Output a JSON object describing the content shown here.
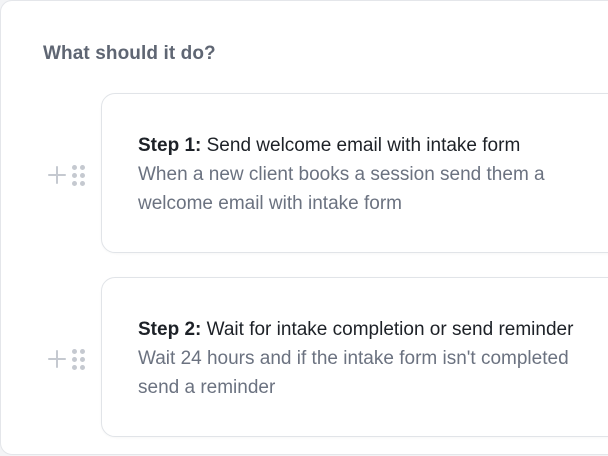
{
  "section": {
    "heading": "What should it do?"
  },
  "steps": [
    {
      "number_label": "Step 1:",
      "title": " Send welcome email with intake form",
      "description": "When a new client books a session send them a welcome email with intake form"
    },
    {
      "number_label": "Step 2:",
      "title": " Wait for intake completion or send reminder",
      "description": "Wait 24 hours and if the intake form isn't completed send a reminder"
    }
  ],
  "icons": {
    "add": "plus-icon",
    "drag": "drag-handle-icon"
  },
  "colors": {
    "heading": "#5f6673",
    "title": "#1d2127",
    "description": "#6b7280",
    "icon": "#c5c9d0",
    "border": "#e1e4e8"
  }
}
